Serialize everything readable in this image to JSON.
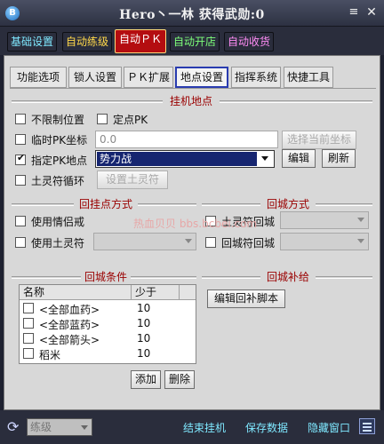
{
  "window": {
    "app_icon": "B",
    "title": "Hero丶一林 获得武勋:0",
    "collapse_icon": "≡",
    "close_icon": "✕"
  },
  "top_tabs": [
    {
      "label": "基础设置",
      "color": "#7fe8ff"
    },
    {
      "label": "自动练级",
      "color": "#ffd84a"
    },
    {
      "label": "自动ＰＫ",
      "active": true
    },
    {
      "label": "自动开店",
      "color": "#7dff7a"
    },
    {
      "label": "自动收货",
      "color": "#ff8cf5"
    }
  ],
  "sub_tabs": [
    {
      "label": "功能选项"
    },
    {
      "label": "锁人设置"
    },
    {
      "label": "ＰＫ扩展"
    },
    {
      "label": "地点设置",
      "active": true
    },
    {
      "label": "指挥系统"
    },
    {
      "label": "快捷工具"
    }
  ],
  "hang_location": {
    "title": "挂机地点",
    "unlimited_position": {
      "label": "不限制位置",
      "checked": false
    },
    "fixed_point_pk": {
      "label": "定点PK",
      "checked": false
    },
    "temp_pk_coords": {
      "label": "临时PK坐标",
      "checked": false,
      "value": "0.0"
    },
    "select_current_coords": "选择当前坐标",
    "designated_pk_location": {
      "label": "指定PK地点",
      "checked": true,
      "value": "势力战"
    },
    "edit": "编辑",
    "refresh": "刷新",
    "earth_talisman_loop": {
      "label": "土灵符循环",
      "checked": false
    },
    "set_earth_talisman": "设置土灵符"
  },
  "return_hang_method": {
    "title": "回挂点方式",
    "use_couple_ring": {
      "label": "使用情侣戒",
      "checked": false
    },
    "use_earth_talisman": {
      "label": "使用土灵符",
      "checked": false
    }
  },
  "return_city_method": {
    "title": "回城方式",
    "earth_talisman_return": {
      "label": "土灵符回城",
      "checked": false
    },
    "return_scroll": {
      "label": "回城符回城",
      "checked": false
    }
  },
  "watermark": "热血贝贝 bbs.bcbei.com",
  "return_conditions": {
    "title": "回城条件",
    "columns": [
      "名称",
      "少于"
    ],
    "rows": [
      {
        "name": "<全部血药>",
        "value": "10",
        "checked": false
      },
      {
        "name": "<全部蓝药>",
        "value": "10",
        "checked": false
      },
      {
        "name": "<全部箭头>",
        "value": "10",
        "checked": false
      },
      {
        "name": "稻米",
        "value": "10",
        "checked": false
      }
    ],
    "add": "添加",
    "delete": "删除"
  },
  "return_replenish": {
    "title": "回城补给",
    "edit_script": "编辑回补脚本"
  },
  "bottom": {
    "refresh_icon": "⟳",
    "level_select": "练级",
    "end_hang": "结束挂机",
    "save_data": "保存数据",
    "hide_window": "隐藏窗口"
  }
}
